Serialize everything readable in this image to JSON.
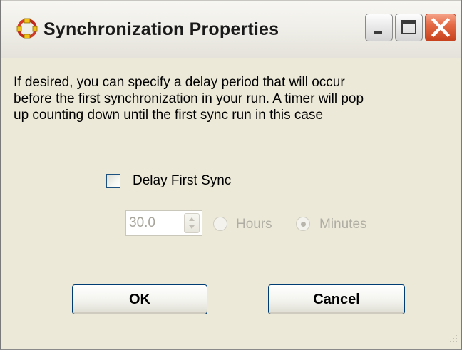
{
  "window": {
    "title": "Synchronization Properties"
  },
  "description": "If desired, you can specify a delay period that will occur\nbefore the first synchronization in your run.  A timer will pop\nup counting down until the first sync run in this case",
  "delay_checkbox": {
    "label": "Delay First Sync",
    "checked": false
  },
  "delay": {
    "value": "30.0",
    "enabled": false,
    "units": [
      {
        "label": "Hours",
        "selected": false
      },
      {
        "label": "Minutes",
        "selected": true
      }
    ]
  },
  "buttons": {
    "ok": "OK",
    "cancel": "Cancel"
  },
  "icons": {
    "app": "sync-app-icon",
    "minimize": "minimize-icon",
    "maximize": "maximize-icon",
    "close": "close-icon",
    "spinner": "spinner-arrows-icon",
    "resize": "resize-grip-icon"
  },
  "colors": {
    "window_bg": "#ece9d8",
    "close_button": "#e46a45",
    "button_border": "#003c74",
    "disabled_text": "#b0aea4"
  }
}
